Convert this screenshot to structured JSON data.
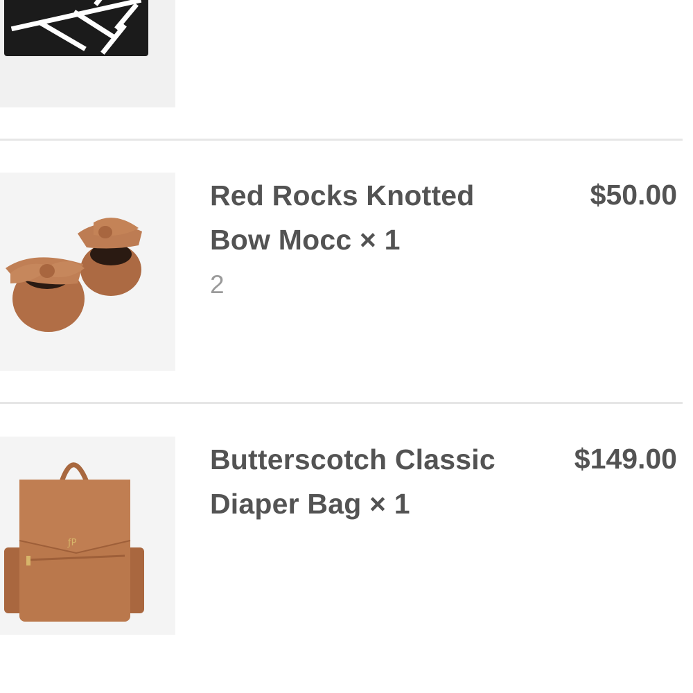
{
  "cart": {
    "items": [
      {
        "title_line1": "",
        "title_line2": "",
        "subtitle": "",
        "price": "",
        "image_icon": "black-graphic-product-image"
      },
      {
        "title_line1": "Red Rocks Knotted",
        "title_line2": "Bow Mocc × 1",
        "subtitle": "2",
        "price": "$50.00",
        "image_icon": "baby-moccasins-image"
      },
      {
        "title_line1": "Butterscotch Classic",
        "title_line2": "Diaper Bag × 1",
        "subtitle": "",
        "price": "$149.00",
        "image_icon": "diaper-backpack-image"
      }
    ]
  },
  "colors": {
    "text": "#535353",
    "muted_text": "#9a9a9a",
    "divider": "#e6e6e6",
    "thumb_bg": "#f2f2f2",
    "leather": "#b9764a"
  }
}
